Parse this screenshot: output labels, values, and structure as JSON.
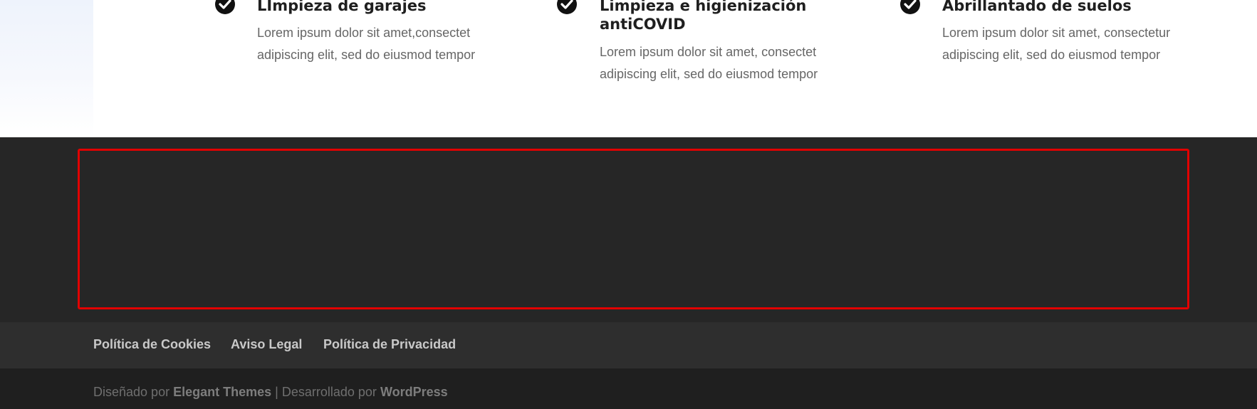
{
  "features": [
    {
      "title_lines": [
        "LImpieza de garajes"
      ],
      "text_lines": [
        "Lorem ipsum dolor sit amet,consectet",
        "adipiscing elit, sed do eiusmod tempor"
      ]
    },
    {
      "title_lines": [
        "Limpieza e higienización",
        "antiCOVID"
      ],
      "text_lines": [
        "Lorem ipsum dolor sit amet, consectet",
        "adipiscing elit, sed do eiusmod tempor"
      ]
    },
    {
      "title_lines": [
        "Abrillantado de suelos"
      ],
      "text_lines": [
        "Lorem ipsum dolor sit amet, consectetur",
        "adipiscing elit, sed do eiusmod tempor"
      ]
    }
  ],
  "footer_links": [
    "Política de Cookies",
    "Aviso Legal",
    "Política de Privacidad"
  ],
  "credits": {
    "designed_by_prefix": "Diseñado por",
    "designer": "Elegant Themes",
    "separator": "|",
    "developed_by_prefix": "Desarrollado por",
    "platform": "WordPress"
  },
  "colors": {
    "highlight_border": "#e20000",
    "dark_widget_area": "#262626",
    "footer_nav_bg": "#2e2e2e",
    "footer_bottom_bg": "#1f1f1f"
  },
  "icons": {
    "feature_bullet": "check-circle-icon"
  }
}
